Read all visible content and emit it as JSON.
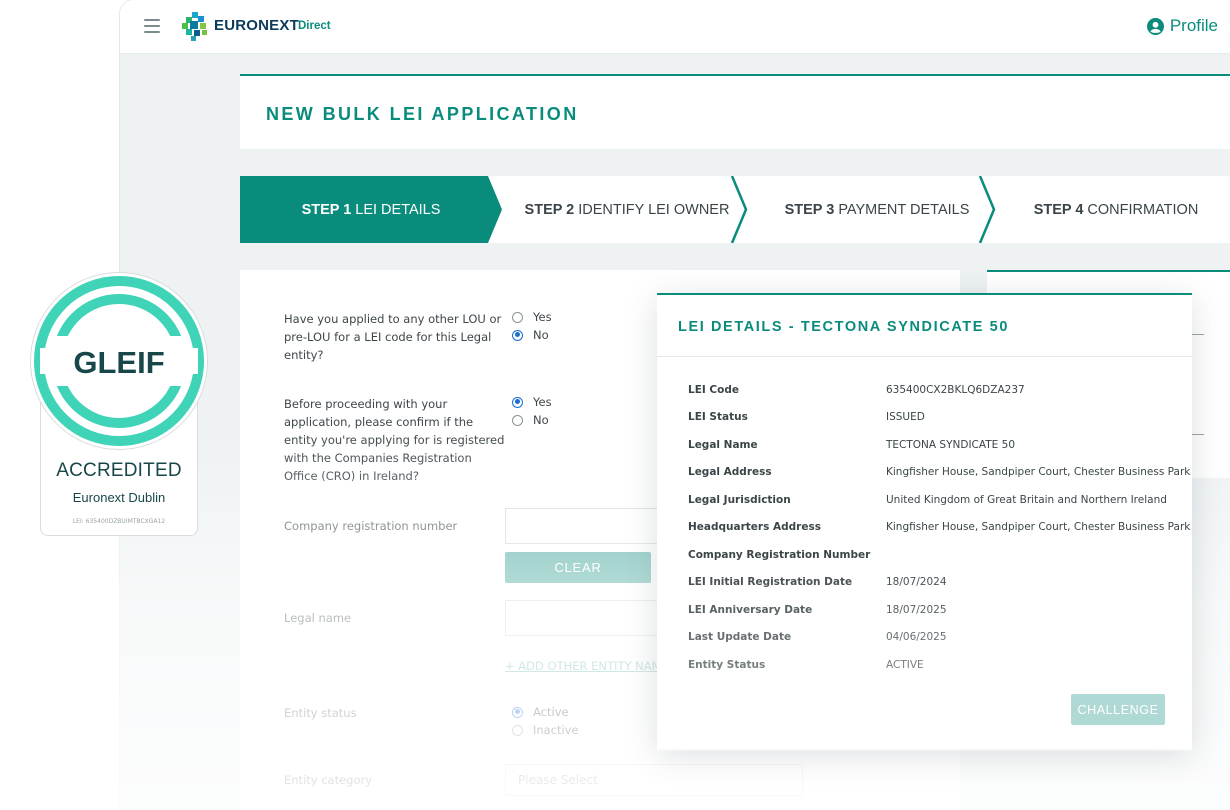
{
  "header": {
    "brand": "EURONEXT",
    "brand_sub": "Direct",
    "profile_label": "Profile"
  },
  "page": {
    "title": "NEW BULK LEI APPLICATION"
  },
  "steps": [
    {
      "num": "STEP 1",
      "label": "LEI DETAILS",
      "active": true
    },
    {
      "num": "STEP 2",
      "label": "IDENTIFY LEI OWNER",
      "active": false
    },
    {
      "num": "STEP 3",
      "label": "PAYMENT DETAILS",
      "active": false
    },
    {
      "num": "STEP 4",
      "label": "CONFIRMATION",
      "active": false
    }
  ],
  "form": {
    "q1": {
      "text": "Have you applied to any other LOU or pre-LOU for a LEI code for this Legal entity?",
      "options": [
        "Yes",
        "No"
      ],
      "selected": "No"
    },
    "q2": {
      "text": "Before proceeding with your application, please confirm if the entity you're applying for is registered with the Companies Registration Office (CRO) in Ireland?",
      "options": [
        "Yes",
        "No"
      ],
      "selected": "Yes"
    },
    "company_reg_label": "Company registration number",
    "clear_label": "CLEAR",
    "legal_name_label": "Legal name",
    "add_entity_link": "+ ADD OTHER ENTITY NAME",
    "entity_status": {
      "label": "Entity status",
      "options": [
        "Active",
        "Inactive"
      ],
      "selected": "Active"
    },
    "entity_category": {
      "label": "Entity category",
      "placeholder": "Please Select"
    }
  },
  "badge": {
    "logo_text": "GLEIF",
    "title": "ACCREDITED",
    "subtitle": "Euronext Dublin",
    "lei": "LEI: 635400DZBUIMTBCXGA12"
  },
  "modal": {
    "title": "LEI DETAILS - TECTONA SYNDICATE 50",
    "rows": [
      {
        "key": "LEI Code",
        "value": "635400CX2BKLQ6DZA237"
      },
      {
        "key": "LEI Status",
        "value": "ISSUED"
      },
      {
        "key": "Legal Name",
        "value": "TECTONA SYNDICATE 50"
      },
      {
        "key": "Legal Address",
        "value": "Kingfisher House, Sandpiper Court, Chester Business Park"
      },
      {
        "key": "Legal Jurisdiction",
        "value": "United Kingdom of Great Britain and Northern Ireland"
      },
      {
        "key": "Headquarters Address",
        "value": "Kingfisher House, Sandpiper Court, Chester Business Park"
      },
      {
        "key": "Company Registration Number",
        "value": ""
      },
      {
        "key": "LEI Initial Registration Date",
        "value": "18/07/2024"
      },
      {
        "key": "LEI Anniversary Date",
        "value": "18/07/2025"
      },
      {
        "key": "Last Update Date",
        "value": "04/06/2025"
      },
      {
        "key": "Entity Status",
        "value": "ACTIVE"
      }
    ],
    "challenge_label": "CHALLENGE"
  },
  "colors": {
    "accent": "#0a8c7d",
    "gleif_teal": "#3fd4b8",
    "brand_navy": "#0b3a5a"
  }
}
